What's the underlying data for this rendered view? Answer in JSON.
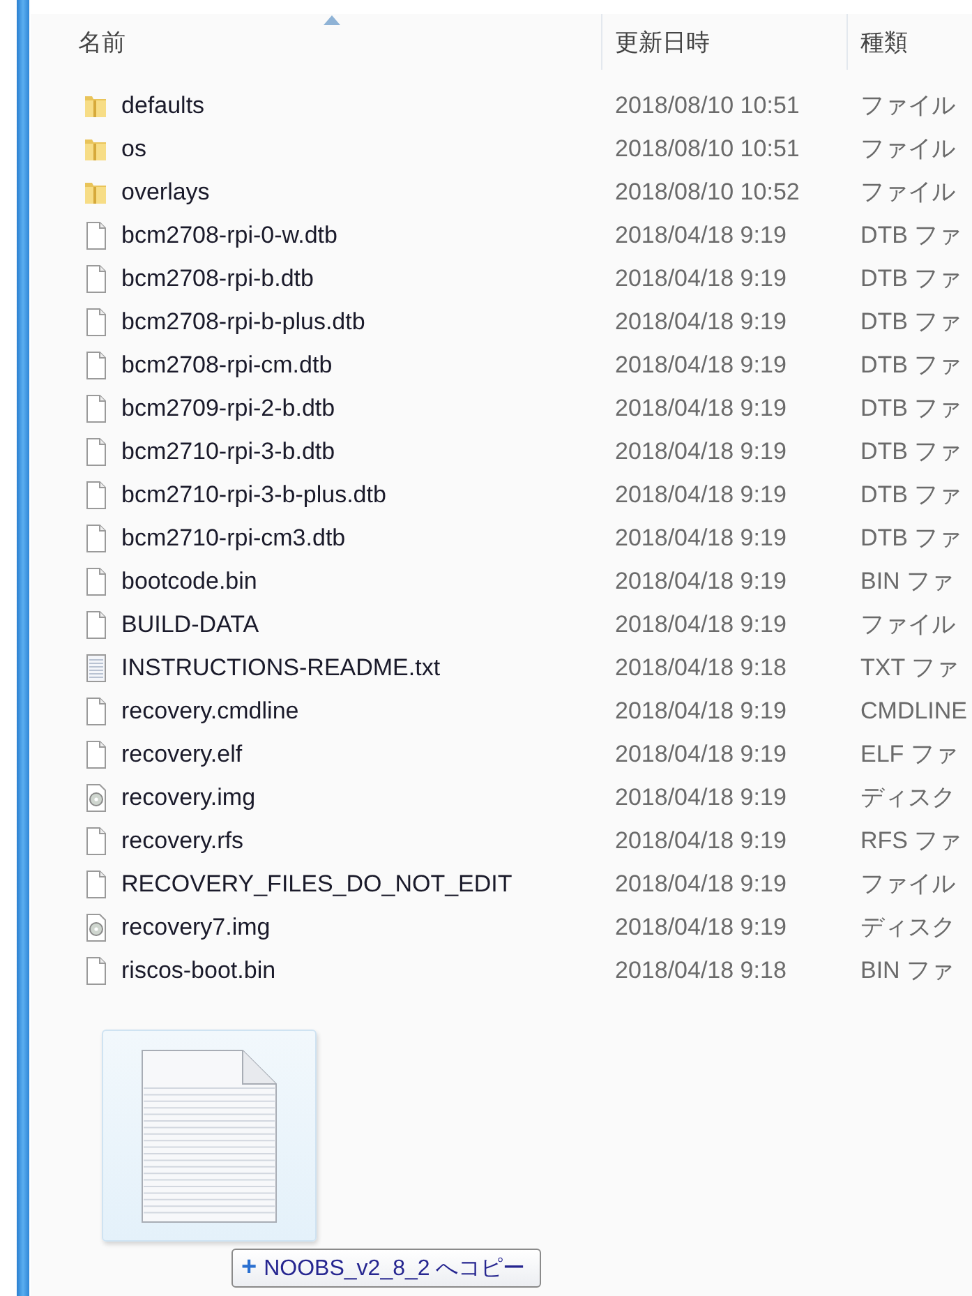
{
  "columns": [
    {
      "label": "名前",
      "sorted": true
    },
    {
      "label": "更新日時",
      "sorted": false
    },
    {
      "label": "種類",
      "sorted": false
    }
  ],
  "rows": [
    {
      "kind": "folder",
      "name": "defaults",
      "date": "2018/08/10 10:51",
      "type": "ファイル"
    },
    {
      "kind": "folder",
      "name": "os",
      "date": "2018/08/10 10:51",
      "type": "ファイル"
    },
    {
      "kind": "folder",
      "name": "overlays",
      "date": "2018/08/10 10:52",
      "type": "ファイル"
    },
    {
      "kind": "file",
      "name": "bcm2708-rpi-0-w.dtb",
      "date": "2018/04/18 9:19",
      "type": "DTB ファ"
    },
    {
      "kind": "file",
      "name": "bcm2708-rpi-b.dtb",
      "date": "2018/04/18 9:19",
      "type": "DTB ファ"
    },
    {
      "kind": "file",
      "name": "bcm2708-rpi-b-plus.dtb",
      "date": "2018/04/18 9:19",
      "type": "DTB ファ"
    },
    {
      "kind": "file",
      "name": "bcm2708-rpi-cm.dtb",
      "date": "2018/04/18 9:19",
      "type": "DTB ファ"
    },
    {
      "kind": "file",
      "name": "bcm2709-rpi-2-b.dtb",
      "date": "2018/04/18 9:19",
      "type": "DTB ファ"
    },
    {
      "kind": "file",
      "name": "bcm2710-rpi-3-b.dtb",
      "date": "2018/04/18 9:19",
      "type": "DTB ファ"
    },
    {
      "kind": "file",
      "name": "bcm2710-rpi-3-b-plus.dtb",
      "date": "2018/04/18 9:19",
      "type": "DTB ファ"
    },
    {
      "kind": "file",
      "name": "bcm2710-rpi-cm3.dtb",
      "date": "2018/04/18 9:19",
      "type": "DTB ファ"
    },
    {
      "kind": "file",
      "name": "bootcode.bin",
      "date": "2018/04/18 9:19",
      "type": "BIN ファ"
    },
    {
      "kind": "file",
      "name": "BUILD-DATA",
      "date": "2018/04/18 9:19",
      "type": "ファイル"
    },
    {
      "kind": "text",
      "name": "INSTRUCTIONS-README.txt",
      "date": "2018/04/18 9:18",
      "type": "TXT ファ"
    },
    {
      "kind": "file",
      "name": "recovery.cmdline",
      "date": "2018/04/18 9:19",
      "type": "CMDLINE"
    },
    {
      "kind": "file",
      "name": "recovery.elf",
      "date": "2018/04/18 9:19",
      "type": "ELF ファ"
    },
    {
      "kind": "disk",
      "name": "recovery.img",
      "date": "2018/04/18 9:19",
      "type": "ディスク"
    },
    {
      "kind": "file",
      "name": "recovery.rfs",
      "date": "2018/04/18 9:19",
      "type": "RFS ファ"
    },
    {
      "kind": "file",
      "name": "RECOVERY_FILES_DO_NOT_EDIT",
      "date": "2018/04/18 9:19",
      "type": "ファイル"
    },
    {
      "kind": "disk",
      "name": "recovery7.img",
      "date": "2018/04/18 9:19",
      "type": "ディスク"
    },
    {
      "kind": "file",
      "name": "riscos-boot.bin",
      "date": "2018/04/18 9:18",
      "type": "BIN ファ"
    }
  ],
  "drag": {
    "tooltip_icon": "+",
    "tooltip": "NOOBS_v2_8_2 へコピー"
  }
}
